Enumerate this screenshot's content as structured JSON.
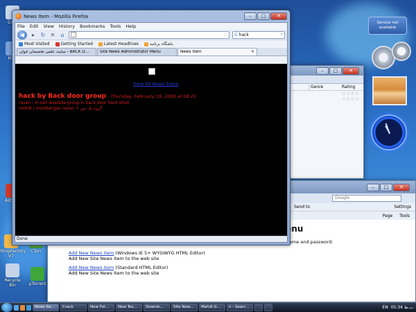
{
  "desktop": {
    "icons": [
      {
        "label": "Com",
        "color": "#c8d8ef"
      },
      {
        "label": "Men",
        "color": "#7aa0d8"
      },
      {
        "label": "Asta Pa",
        "color": "#d23a2a"
      },
      {
        "label": "ShopFactory V7",
        "color": "#f2b84a"
      },
      {
        "label": "CTorr",
        "color": "#4b9b3a"
      },
      {
        "label": "Recycle Bin",
        "color": "#c6d4e8"
      },
      {
        "label": "µTorrent",
        "color": "#3fa63a"
      }
    ],
    "gadget_text": "Service not available"
  },
  "firefox": {
    "title": "News Item - Mozilla Firefox",
    "menu": [
      "File",
      "Edit",
      "View",
      "History",
      "Bookmarks",
      "Tools",
      "Help"
    ],
    "url": "",
    "search_value": "hack",
    "bookmarks": [
      {
        "label": "Most Visited",
        "color": "#3a7fd8"
      },
      {
        "label": "Getting Started",
        "color": "#d8342a"
      },
      {
        "label": "Latest Headlines",
        "color": "#f2a33a"
      },
      {
        "label": "باشگاه برنامه",
        "color": "#f2a33a"
      }
    ],
    "tabs": [
      {
        "label": "سایت علمی تخصصان جوان - BACK D...",
        "active": false
      },
      {
        "label": "Site News Administrator Menu",
        "active": false
      },
      {
        "label": "News Item",
        "active": true
      }
    ],
    "page": {
      "link": "View All News Items",
      "headline": "hack by Back door group",
      "date": "- Thursday, February 19, 2009 at 08:21",
      "line1": "raven - in xall levelsite group in back door hack shod",
      "line2": "mehdi / mostbergan raven + گروه بک دور"
    },
    "status": "Done"
  },
  "ie_window": {
    "search_placeholder": "Google",
    "toolbar": [
      "Send to",
      "Settings",
      "Page",
      "Tools"
    ],
    "page_title": "Site News Administrator Menu",
    "notice": "It is highly recommend for security reasons that you change the username and password.",
    "entries": [
      {
        "link": "Add New News Item",
        "suffix": "(Windows IE 5+ WYSIWYG HTML Editor)",
        "desc": "Add New Site News Item to the web site"
      },
      {
        "link": "Add New News Item",
        "suffix": "(Standard HTML Editor)",
        "desc": "Add New Site News Item to the web site"
      }
    ]
  },
  "media_window": {
    "columns": [
      "Genre",
      "Rating"
    ]
  },
  "taskbar": {
    "items": [
      "News Ite...",
      "Crack",
      "New Fol...",
      "New Tex...",
      "Downlo...",
      "Site New...",
      "Mehdi G...",
      "n - Searc...",
      "",
      ""
    ],
    "lang": "EN",
    "clock": "05:34 ب.ظ"
  }
}
